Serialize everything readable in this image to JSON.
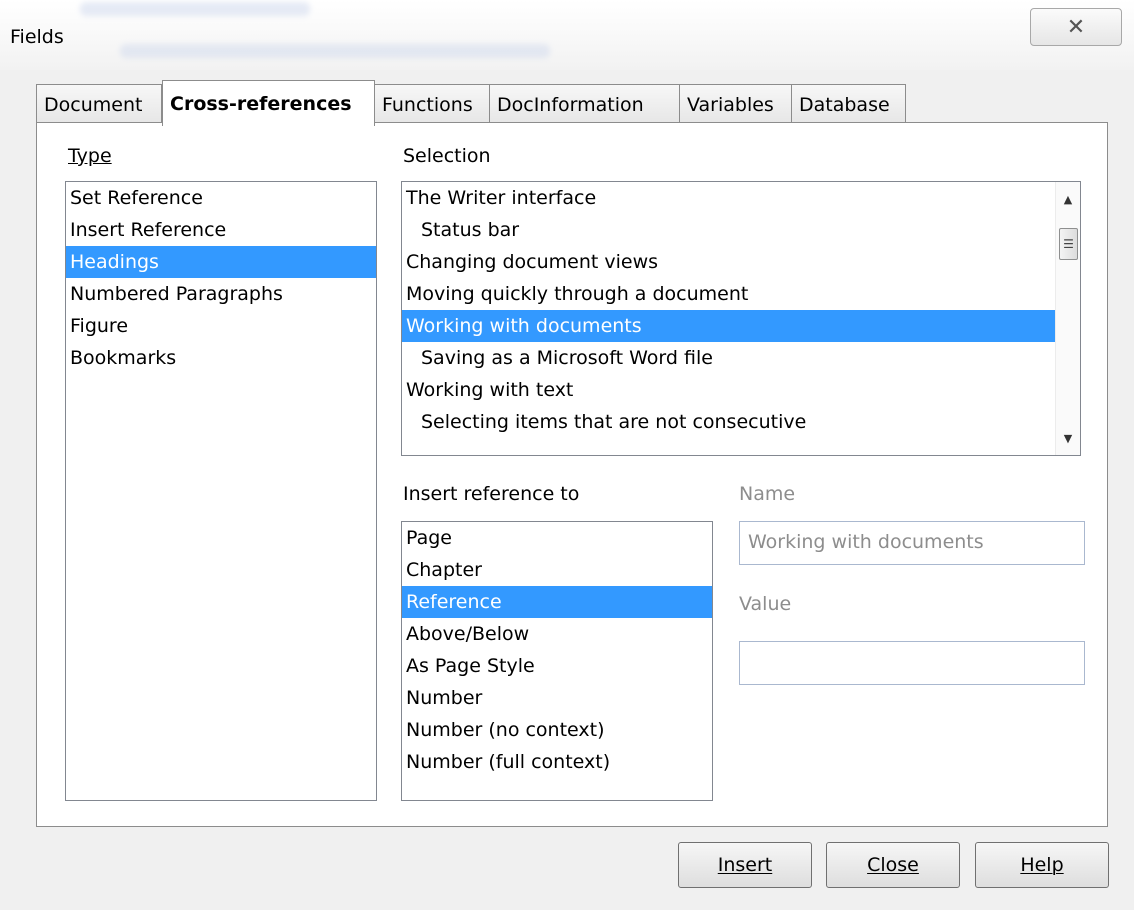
{
  "window": {
    "title": "Fields",
    "close_glyph": "✕"
  },
  "tabs": [
    {
      "label": "Document",
      "active": false
    },
    {
      "label": "Cross-references",
      "active": true
    },
    {
      "label": "Functions",
      "active": false
    },
    {
      "label": "DocInformation",
      "active": false
    },
    {
      "label": "Variables",
      "active": false
    },
    {
      "label": "Database",
      "active": false
    }
  ],
  "type": {
    "label": "Type",
    "items": [
      "Set Reference",
      "Insert Reference",
      "Headings",
      "Numbered Paragraphs",
      "Figure",
      "Bookmarks"
    ],
    "selected": "Headings"
  },
  "selection": {
    "label": "Selection",
    "items": [
      "The Writer interface",
      "Status bar",
      "Changing document views",
      "Moving quickly through a document",
      "Working with documents",
      "Saving as a Microsoft Word file",
      "Working with text",
      "Selecting items that are not consecutive"
    ],
    "selected": "Working with documents"
  },
  "insert_reference": {
    "label": "Insert reference to",
    "items": [
      "Page",
      "Chapter",
      "Reference",
      "Above/Below",
      "As Page Style",
      "Number",
      "Number (no context)",
      "Number (full context)"
    ],
    "selected": "Reference"
  },
  "name_field": {
    "label": "Name",
    "value": "Working with documents"
  },
  "value_field": {
    "label": "Value",
    "value": ""
  },
  "buttons": {
    "insert": "Insert",
    "close": "Close",
    "help": "Help"
  }
}
